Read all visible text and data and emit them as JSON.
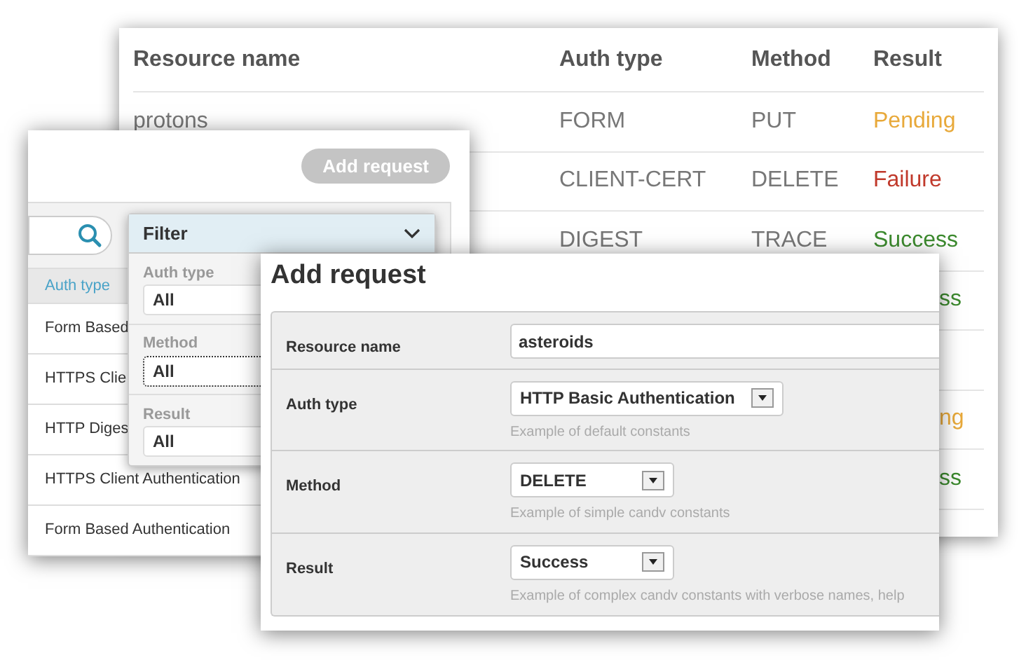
{
  "results_table": {
    "columns": [
      "Resource name",
      "Auth type",
      "Method",
      "Result"
    ],
    "rows": [
      {
        "kind": "full",
        "resource_name": "protons",
        "auth_type": "FORM",
        "method": "PUT",
        "result": "Pending",
        "color": "#e8a93a"
      },
      {
        "kind": "full",
        "auth_type": "CLIENT-CERT",
        "method": "DELETE",
        "result": "Failure",
        "color": "#c0392b"
      },
      {
        "kind": "full",
        "auth_type": "DIGEST",
        "method": "TRACE",
        "result": "Success",
        "color": "#3c8a2e"
      },
      {
        "kind": "partial",
        "result": "ss",
        "color": "#3c8a2e"
      },
      {
        "kind": "blank"
      },
      {
        "kind": "partial",
        "result": "ng",
        "color": "#e8a93a"
      },
      {
        "kind": "partial",
        "result": "ss",
        "color": "#3c8a2e"
      }
    ]
  },
  "list_window": {
    "add_button": {
      "label": "Add request",
      "disabled": true
    },
    "table": {
      "column": "Auth type",
      "rows": [
        "Form Based",
        "HTTPS Clie",
        "HTTP Diges",
        "HTTPS Client Authentication",
        "Form Based Authentication"
      ]
    },
    "filter": {
      "title": "Filter",
      "expanded": true,
      "fields": [
        {
          "label": "Auth type",
          "value": "All",
          "focused": false
        },
        {
          "label": "Method",
          "value": "All",
          "focused": true
        },
        {
          "label": "Result",
          "value": "All",
          "focused": false
        }
      ]
    }
  },
  "dialog": {
    "title": "Add request",
    "fields": [
      {
        "kind": "text",
        "label": "Resource name",
        "value": "asteroids"
      },
      {
        "kind": "select",
        "label": "Auth type",
        "value": "HTTP Basic Authentication",
        "help": "Example of default constants"
      },
      {
        "kind": "select",
        "label": "Method",
        "value": "DELETE",
        "help": "Example of simple candv constants"
      },
      {
        "kind": "select",
        "label": "Result",
        "value": "Success",
        "help": "Example of complex candv constants with verbose names, help"
      }
    ]
  }
}
